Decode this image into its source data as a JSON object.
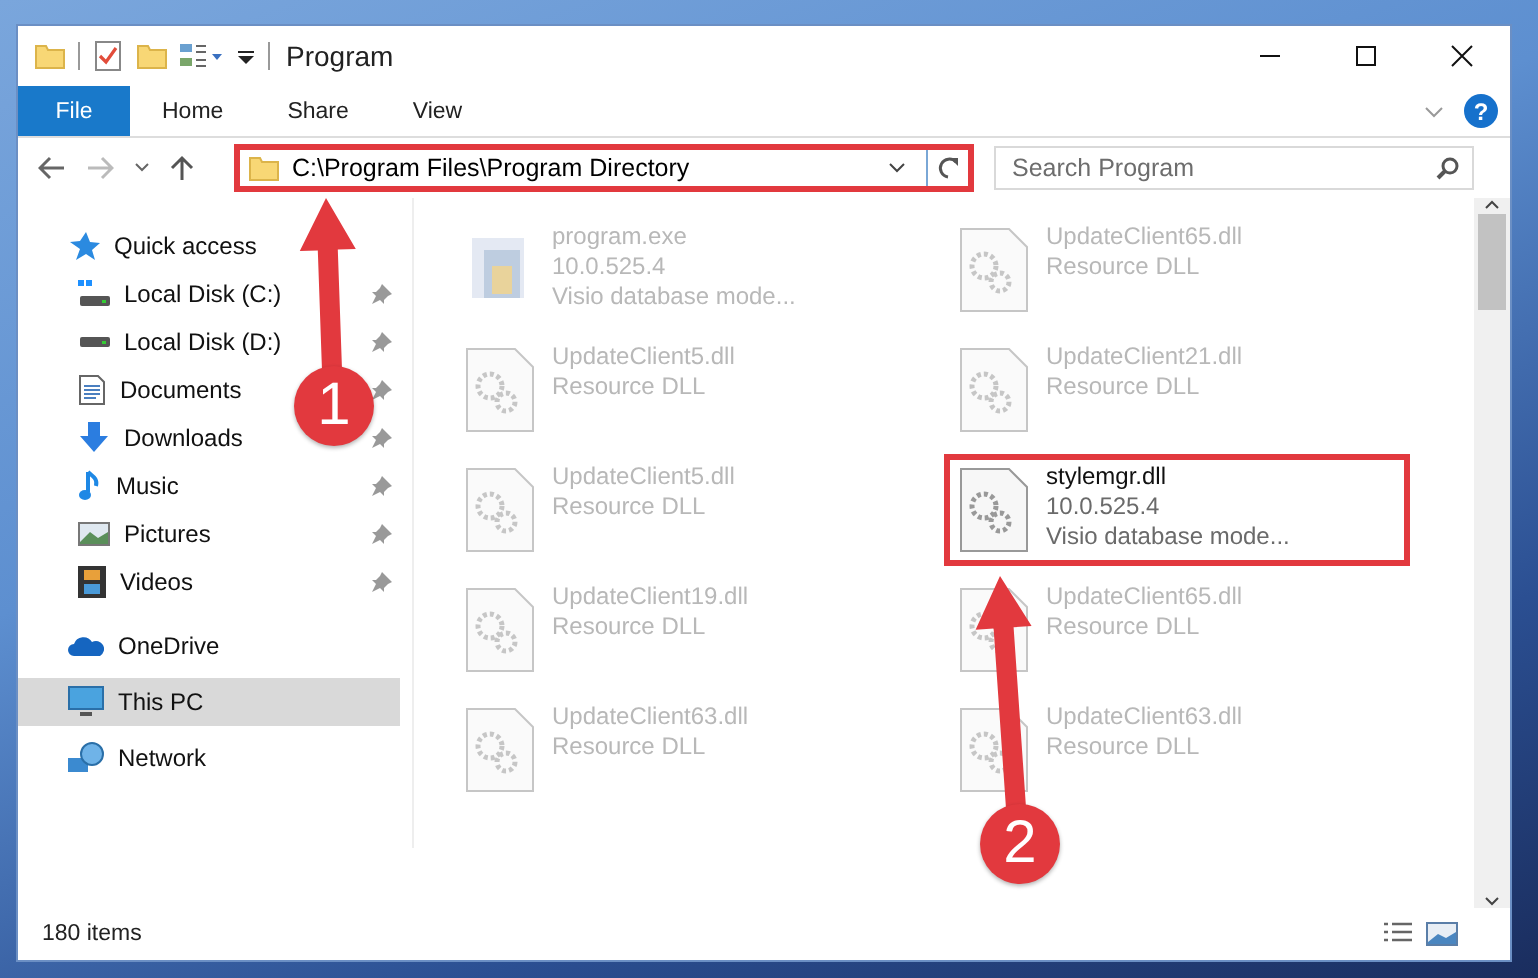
{
  "window": {
    "title": "Program"
  },
  "ribbon": {
    "tabs": [
      {
        "label": "File",
        "kind": "file",
        "selected": false
      },
      {
        "label": "Home",
        "kind": "tab",
        "selected": false
      },
      {
        "label": "Share",
        "kind": "tab",
        "selected": false
      },
      {
        "label": "View",
        "kind": "tab",
        "selected": false
      }
    ],
    "help": "?"
  },
  "address_bar": {
    "path": "C:\\Program Files\\Program Directory",
    "highlighted": true
  },
  "search": {
    "placeholder": "Search Program"
  },
  "navigation": [
    {
      "label": "Quick access",
      "selected": false,
      "children": [
        {
          "label": "Local Disk (C:)",
          "pinned": true,
          "selected": false
        },
        {
          "label": "Local Disk (D:)",
          "pinned": true,
          "selected": false
        },
        {
          "label": "Documents",
          "pinned": true,
          "selected": false
        },
        {
          "label": "Downloads",
          "pinned": true,
          "selected": false
        },
        {
          "label": "Music",
          "pinned": true,
          "selected": false
        },
        {
          "label": "Pictures",
          "pinned": true,
          "selected": false
        },
        {
          "label": "Videos",
          "pinned": true,
          "selected": false
        }
      ]
    },
    {
      "label": "OneDrive",
      "selected": false
    },
    {
      "label": "This PC",
      "selected": true
    },
    {
      "label": "Network",
      "selected": false
    }
  ],
  "files": [
    {
      "name": "program.exe",
      "kind": "exe",
      "details": [
        "10.0.525.4",
        "Visio database mode..."
      ],
      "blurred": true,
      "highlighted": false
    },
    {
      "name": "UpdateClient65.dll",
      "kind": "dll",
      "details": [
        "Resource DLL"
      ],
      "blurred": true,
      "highlighted": false
    },
    {
      "name": "UpdateClient5.dll",
      "kind": "dll",
      "details": [
        "Resource DLL"
      ],
      "blurred": true,
      "highlighted": false
    },
    {
      "name": "UpdateClient21.dll",
      "kind": "dll",
      "details": [
        "Resource DLL"
      ],
      "blurred": true,
      "highlighted": false
    },
    {
      "name": "UpdateClient5.dll",
      "kind": "dll",
      "details": [
        "Resource DLL"
      ],
      "blurred": true,
      "highlighted": false
    },
    {
      "name": "stylemgr.dll",
      "kind": "dll",
      "details": [
        "10.0.525.4",
        "Visio database mode..."
      ],
      "blurred": false,
      "highlighted": true
    },
    {
      "name": "UpdateClient19.dll",
      "kind": "dll",
      "details": [
        "Resource DLL"
      ],
      "blurred": true,
      "highlighted": false
    },
    {
      "name": "UpdateClient65.dll",
      "kind": "dll",
      "details": [
        "Resource DLL"
      ],
      "blurred": true,
      "highlighted": false
    },
    {
      "name": "UpdateClient63.dll",
      "kind": "dll",
      "details": [
        "Resource DLL"
      ],
      "blurred": true,
      "highlighted": false
    },
    {
      "name": "UpdateClient63.dll",
      "kind": "dll",
      "details": [
        "Resource DLL"
      ],
      "blurred": true,
      "highlighted": false
    }
  ],
  "status_bar": {
    "items": "180 items"
  },
  "callouts": [
    {
      "number": "1"
    },
    {
      "number": "2"
    }
  ]
}
